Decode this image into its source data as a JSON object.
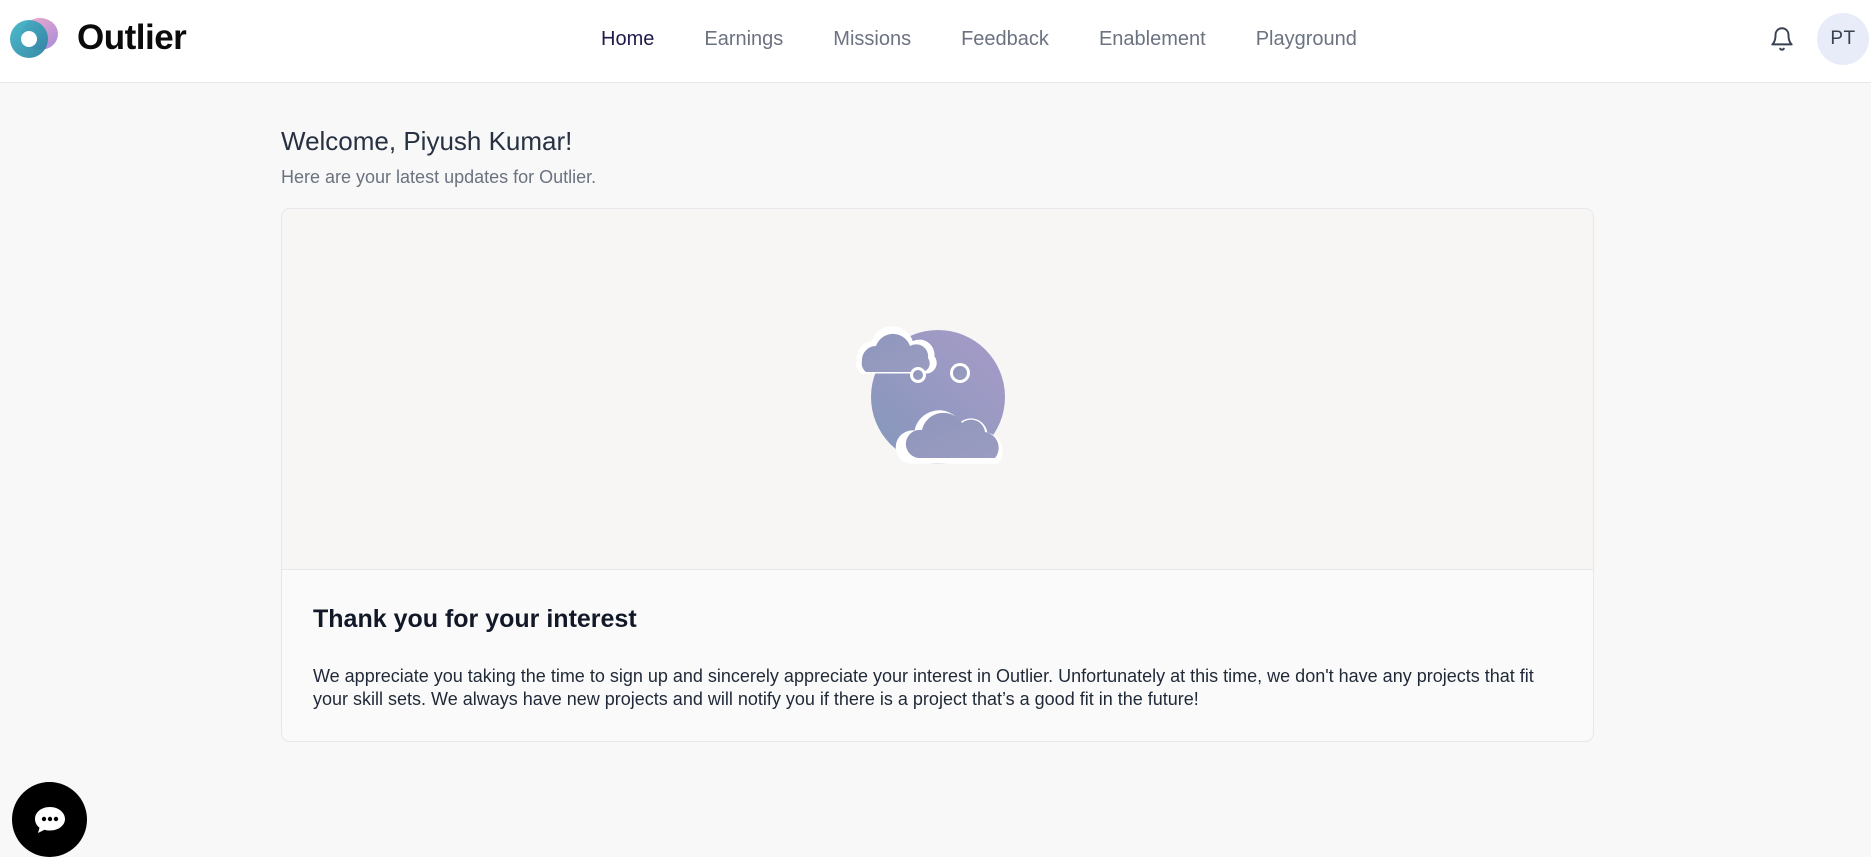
{
  "brand": {
    "name": "Outlier"
  },
  "nav": {
    "items": [
      {
        "label": "Home",
        "active": true
      },
      {
        "label": "Earnings",
        "active": false
      },
      {
        "label": "Missions",
        "active": false
      },
      {
        "label": "Feedback",
        "active": false
      },
      {
        "label": "Enablement",
        "active": false
      },
      {
        "label": "Playground",
        "active": false
      }
    ]
  },
  "header": {
    "notification_icon": "bell-icon",
    "avatar_initials": "PT"
  },
  "main": {
    "welcome": "Welcome, Piyush Kumar!",
    "subtitle": "Here are your latest updates for Outlier.",
    "card": {
      "illustration_icon": "moon-clouds-icon",
      "title": "Thank you for your interest",
      "body": "We appreciate you taking the time to sign up and sincerely appreciate your interest in Outlier. Unfortunately at this time, we don't have any projects that fit your skill sets. We always have new projects and will notify you if there is a project that’s a good fit in the future!"
    }
  },
  "chat": {
    "icon": "chat-bubble-icon"
  },
  "colors": {
    "page_bg": "#f8f8f8",
    "nav_active": "#1e1b4b",
    "nav_inactive": "#6b7280",
    "avatar_bg": "#e8ecf8",
    "illustration_purple": "#a39cc6",
    "illustration_blue": "#8a9cbf"
  }
}
